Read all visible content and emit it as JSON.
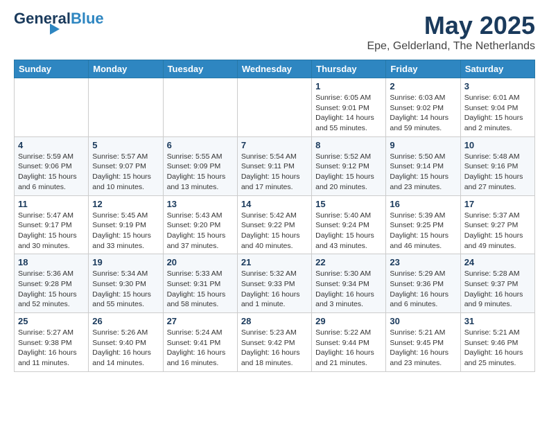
{
  "logo": {
    "part1": "General",
    "part2": "Blue"
  },
  "title": "May 2025",
  "location": "Epe, Gelderland, The Netherlands",
  "weekdays": [
    "Sunday",
    "Monday",
    "Tuesday",
    "Wednesday",
    "Thursday",
    "Friday",
    "Saturday"
  ],
  "weeks": [
    [
      {
        "day": "",
        "info": ""
      },
      {
        "day": "",
        "info": ""
      },
      {
        "day": "",
        "info": ""
      },
      {
        "day": "",
        "info": ""
      },
      {
        "day": "1",
        "info": "Sunrise: 6:05 AM\nSunset: 9:01 PM\nDaylight: 14 hours\nand 55 minutes."
      },
      {
        "day": "2",
        "info": "Sunrise: 6:03 AM\nSunset: 9:02 PM\nDaylight: 14 hours\nand 59 minutes."
      },
      {
        "day": "3",
        "info": "Sunrise: 6:01 AM\nSunset: 9:04 PM\nDaylight: 15 hours\nand 2 minutes."
      }
    ],
    [
      {
        "day": "4",
        "info": "Sunrise: 5:59 AM\nSunset: 9:06 PM\nDaylight: 15 hours\nand 6 minutes."
      },
      {
        "day": "5",
        "info": "Sunrise: 5:57 AM\nSunset: 9:07 PM\nDaylight: 15 hours\nand 10 minutes."
      },
      {
        "day": "6",
        "info": "Sunrise: 5:55 AM\nSunset: 9:09 PM\nDaylight: 15 hours\nand 13 minutes."
      },
      {
        "day": "7",
        "info": "Sunrise: 5:54 AM\nSunset: 9:11 PM\nDaylight: 15 hours\nand 17 minutes."
      },
      {
        "day": "8",
        "info": "Sunrise: 5:52 AM\nSunset: 9:12 PM\nDaylight: 15 hours\nand 20 minutes."
      },
      {
        "day": "9",
        "info": "Sunrise: 5:50 AM\nSunset: 9:14 PM\nDaylight: 15 hours\nand 23 minutes."
      },
      {
        "day": "10",
        "info": "Sunrise: 5:48 AM\nSunset: 9:16 PM\nDaylight: 15 hours\nand 27 minutes."
      }
    ],
    [
      {
        "day": "11",
        "info": "Sunrise: 5:47 AM\nSunset: 9:17 PM\nDaylight: 15 hours\nand 30 minutes."
      },
      {
        "day": "12",
        "info": "Sunrise: 5:45 AM\nSunset: 9:19 PM\nDaylight: 15 hours\nand 33 minutes."
      },
      {
        "day": "13",
        "info": "Sunrise: 5:43 AM\nSunset: 9:20 PM\nDaylight: 15 hours\nand 37 minutes."
      },
      {
        "day": "14",
        "info": "Sunrise: 5:42 AM\nSunset: 9:22 PM\nDaylight: 15 hours\nand 40 minutes."
      },
      {
        "day": "15",
        "info": "Sunrise: 5:40 AM\nSunset: 9:24 PM\nDaylight: 15 hours\nand 43 minutes."
      },
      {
        "day": "16",
        "info": "Sunrise: 5:39 AM\nSunset: 9:25 PM\nDaylight: 15 hours\nand 46 minutes."
      },
      {
        "day": "17",
        "info": "Sunrise: 5:37 AM\nSunset: 9:27 PM\nDaylight: 15 hours\nand 49 minutes."
      }
    ],
    [
      {
        "day": "18",
        "info": "Sunrise: 5:36 AM\nSunset: 9:28 PM\nDaylight: 15 hours\nand 52 minutes."
      },
      {
        "day": "19",
        "info": "Sunrise: 5:34 AM\nSunset: 9:30 PM\nDaylight: 15 hours\nand 55 minutes."
      },
      {
        "day": "20",
        "info": "Sunrise: 5:33 AM\nSunset: 9:31 PM\nDaylight: 15 hours\nand 58 minutes."
      },
      {
        "day": "21",
        "info": "Sunrise: 5:32 AM\nSunset: 9:33 PM\nDaylight: 16 hours\nand 1 minute."
      },
      {
        "day": "22",
        "info": "Sunrise: 5:30 AM\nSunset: 9:34 PM\nDaylight: 16 hours\nand 3 minutes."
      },
      {
        "day": "23",
        "info": "Sunrise: 5:29 AM\nSunset: 9:36 PM\nDaylight: 16 hours\nand 6 minutes."
      },
      {
        "day": "24",
        "info": "Sunrise: 5:28 AM\nSunset: 9:37 PM\nDaylight: 16 hours\nand 9 minutes."
      }
    ],
    [
      {
        "day": "25",
        "info": "Sunrise: 5:27 AM\nSunset: 9:38 PM\nDaylight: 16 hours\nand 11 minutes."
      },
      {
        "day": "26",
        "info": "Sunrise: 5:26 AM\nSunset: 9:40 PM\nDaylight: 16 hours\nand 14 minutes."
      },
      {
        "day": "27",
        "info": "Sunrise: 5:24 AM\nSunset: 9:41 PM\nDaylight: 16 hours\nand 16 minutes."
      },
      {
        "day": "28",
        "info": "Sunrise: 5:23 AM\nSunset: 9:42 PM\nDaylight: 16 hours\nand 18 minutes."
      },
      {
        "day": "29",
        "info": "Sunrise: 5:22 AM\nSunset: 9:44 PM\nDaylight: 16 hours\nand 21 minutes."
      },
      {
        "day": "30",
        "info": "Sunrise: 5:21 AM\nSunset: 9:45 PM\nDaylight: 16 hours\nand 23 minutes."
      },
      {
        "day": "31",
        "info": "Sunrise: 5:21 AM\nSunset: 9:46 PM\nDaylight: 16 hours\nand 25 minutes."
      }
    ]
  ]
}
